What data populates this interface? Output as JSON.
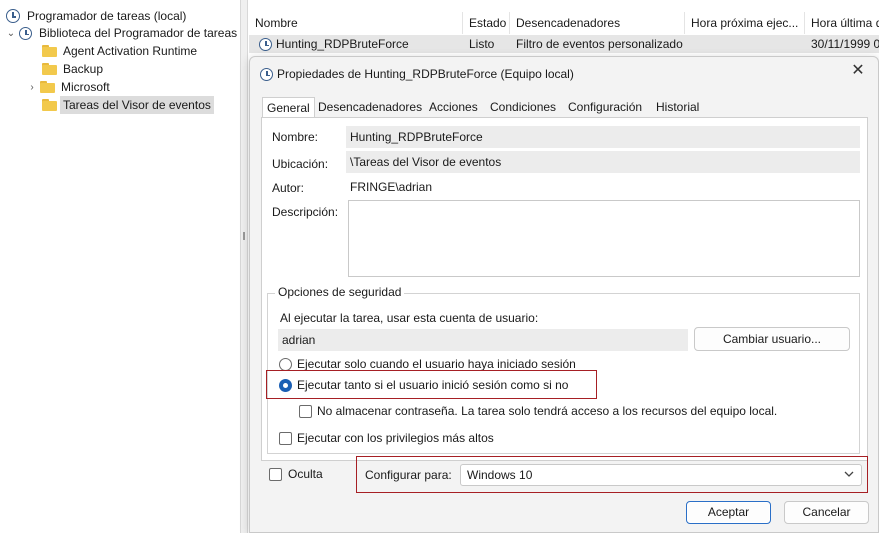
{
  "tree": {
    "root": "Programador de tareas (local)",
    "library": "Biblioteca del Programador de tareas",
    "folders": [
      "Agent Activation Runtime",
      "Backup",
      "Microsoft",
      "Tareas del Visor de eventos"
    ]
  },
  "tasklist": {
    "columns": [
      "Nombre",
      "Estado",
      "Desencadenadores",
      "Hora próxima ejec...",
      "Hora última d"
    ],
    "row": {
      "name": "Hunting_RDPBruteForce",
      "status": "Listo",
      "trigger": "Filtro de eventos personalizado",
      "next_run": "",
      "last_run": "30/11/1999 0"
    }
  },
  "dialog": {
    "title": "Propiedades de Hunting_RDPBruteForce (Equipo local)",
    "tabs": [
      "General",
      "Desencadenadores",
      "Acciones",
      "Condiciones",
      "Configuración",
      "Historial"
    ],
    "general": {
      "name_label": "Nombre:",
      "name_value": "Hunting_RDPBruteForce",
      "location_label": "Ubicación:",
      "location_value": "\\Tareas del Visor de eventos",
      "author_label": "Autor:",
      "author_value": "FRINGE\\adrian",
      "description_label": "Descripción:",
      "description_value": ""
    },
    "security": {
      "legend": "Opciones de seguridad",
      "account_prompt": "Al ejecutar la tarea, usar esta cuenta de usuario:",
      "account_value": "adrian",
      "change_user_button": "Cambiar usuario...",
      "radio_logged_on": "Ejecutar solo cuando el usuario haya iniciado sesión",
      "radio_whether": "Ejecutar tanto si el usuario inició sesión como si no",
      "no_store_password": "No almacenar contraseña. La tarea solo tendrá acceso a los recursos del equipo local.",
      "highest_privileges": "Ejecutar con los privilegios más altos"
    },
    "hidden_label": "Oculta",
    "configure_label": "Configurar para:",
    "configure_value": "Windows 10",
    "ok_button": "Aceptar",
    "cancel_button": "Cancelar"
  },
  "colors": {
    "highlight": "#a61f24",
    "radio_selected": "#1a5fb4",
    "folder": "#f2c94c"
  }
}
